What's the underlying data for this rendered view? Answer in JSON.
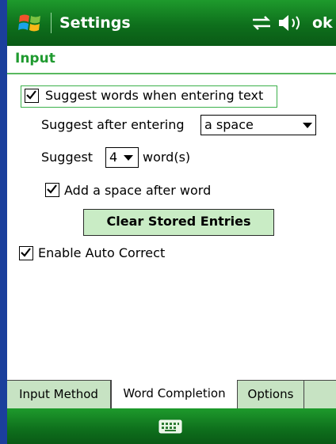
{
  "titlebar": {
    "title": "Settings",
    "ok_label": "ok",
    "icons": [
      "windows-start-icon",
      "connectivity-icon",
      "volume-icon"
    ]
  },
  "section": {
    "title": "Input"
  },
  "options": {
    "suggest_words": {
      "label": "Suggest words when entering text",
      "checked": true
    },
    "suggest_after": {
      "label": "Suggest after entering",
      "value": "a space"
    },
    "suggest_count": {
      "prefix": "Suggest",
      "value": "4",
      "suffix": "word(s)"
    },
    "add_space": {
      "label": "Add a space after word",
      "checked": true
    },
    "clear_button": "Clear Stored Entries",
    "auto_correct": {
      "label": "Enable Auto Correct",
      "checked": true
    }
  },
  "tabs": [
    {
      "label": "Input Method",
      "active": false
    },
    {
      "label": "Word Completion",
      "active": true
    },
    {
      "label": "Options",
      "active": false
    }
  ],
  "bottombar": {
    "icon": "keyboard-icon"
  },
  "colors": {
    "title_green": "#0e6f1c",
    "header_text": "#1f9a2f",
    "button_bg": "#c9ecc5",
    "tabbar_bg": "#c7e3c3",
    "left_edge_blue": "#1b3f9c"
  }
}
